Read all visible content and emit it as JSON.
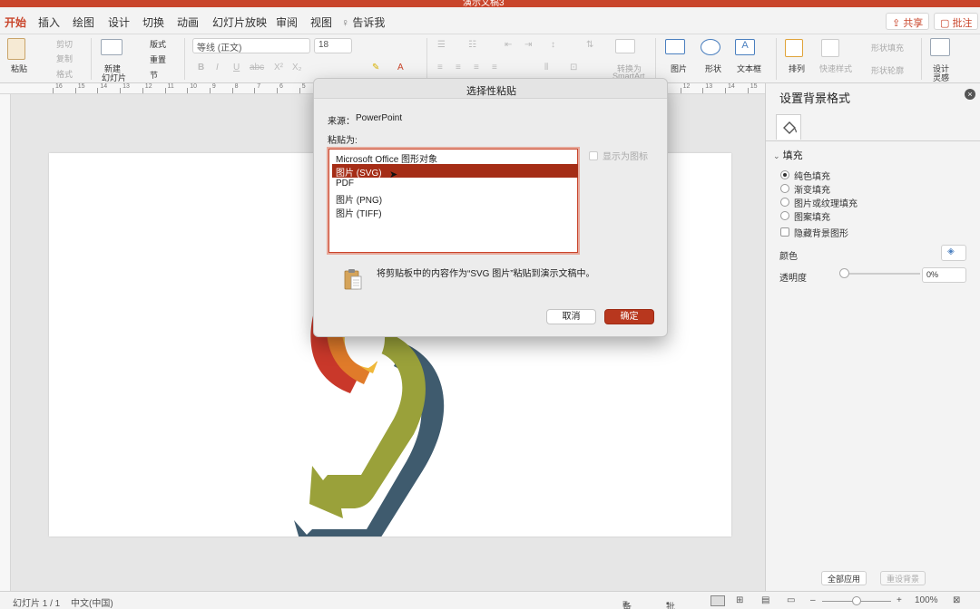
{
  "window": {
    "title": "演示文稿3"
  },
  "tabs": [
    {
      "label": "开始",
      "active": true
    },
    {
      "label": "插入"
    },
    {
      "label": "绘图"
    },
    {
      "label": "设计"
    },
    {
      "label": "切换"
    },
    {
      "label": "动画"
    },
    {
      "label": "幻灯片放映"
    },
    {
      "label": "审阅"
    },
    {
      "label": "视图"
    },
    {
      "label": "告诉我"
    }
  ],
  "tab_actions": {
    "share": "共享",
    "comments": "批注"
  },
  "ribbon": {
    "paste": "粘贴",
    "cut": "剪切",
    "copy": "复制",
    "format": "格式",
    "new_slide_1": "新建",
    "new_slide_2": "幻灯片",
    "layout": "版式",
    "reset": "重置",
    "section": "节",
    "font_name": "等线 (正文)",
    "font_size": "18",
    "convert_smartart_1": "转换为",
    "convert_smartart_2": "SmartArt",
    "picture": "图片",
    "shape": "形状",
    "textbox": "文本框",
    "arrange": "排列",
    "quick_styles": "快速样式",
    "shape_fill": "形状填充",
    "shape_outline": "形状轮廓",
    "design_ideas_1": "设计",
    "design_ideas_2": "灵感",
    "font_buttons": [
      "B",
      "I",
      "U",
      "abc",
      "X²",
      "X₂"
    ]
  },
  "ruler_numbers": [
    "16",
    "15",
    "14",
    "13",
    "12",
    "11",
    "10",
    "9",
    "8",
    "7",
    "6",
    "5",
    "4",
    "3",
    "2",
    "1",
    "0",
    "1",
    "2",
    "3",
    "4",
    "5",
    "6",
    "7",
    "8",
    "9",
    "10",
    "11",
    "12",
    "13",
    "14",
    "15",
    "16"
  ],
  "dialog": {
    "title": "选择性粘贴",
    "source_label": "来源：",
    "source_value": "PowerPoint",
    "paste_as_label": "粘贴为:",
    "options": [
      {
        "label": "Microsoft Office 图形对象",
        "selected": false
      },
      {
        "label": "图片 (SVG)",
        "selected": true
      },
      {
        "label": "PDF",
        "selected": false
      },
      {
        "label": "图片 (PNG)",
        "selected": false
      },
      {
        "label": "图片 (TIFF)",
        "selected": false
      }
    ],
    "display_as_icon": "显示为图标",
    "result_text": "将剪贴板中的内容作为“SVG 图片”粘贴到演示文稿中。",
    "cancel": "取消",
    "ok": "确定"
  },
  "panel": {
    "title": "设置背景格式",
    "section": "填充",
    "fill_options": [
      {
        "label": "纯色填充",
        "selected": true
      },
      {
        "label": "渐变填充",
        "selected": false
      },
      {
        "label": "图片或纹理填充",
        "selected": false
      },
      {
        "label": "图案填充",
        "selected": false
      }
    ],
    "hide_bg_graphics": "隐藏背景图形",
    "color_label": "颜色",
    "transparency_label": "透明度",
    "transparency_value": "0%",
    "transparency": 0,
    "apply_all": "全部应用",
    "reset_bg": "重设背景"
  },
  "status": {
    "slide_info": "幻灯片 1 / 1",
    "language": "中文(中国)",
    "notes": "备注",
    "comments": "批注",
    "zoom": "100%"
  },
  "colors": {
    "accent": "#c9452b",
    "selection": "#a52d16",
    "shape_olive": "#9aa13a",
    "shape_slate": "#3f5b6e",
    "shape_orange": "#e07b2a",
    "shape_red": "#c9382a",
    "shape_yellow": "#f0b83a"
  }
}
